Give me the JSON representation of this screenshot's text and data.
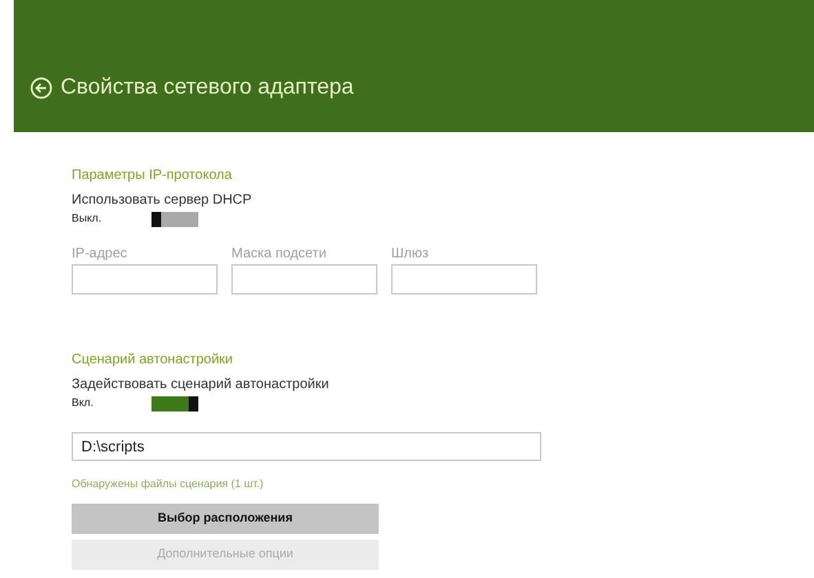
{
  "header": {
    "title": "Свойства сетевого адаптера"
  },
  "sections": [
    {
      "title": "Параметры IP-протокола",
      "toggle": {
        "label": "Использовать сервер DHCP",
        "state_text": "Выкл.",
        "on": false
      },
      "fields": [
        {
          "label": "IP-адрес"
        },
        {
          "label": "Маска подсети"
        },
        {
          "label": "Шлюз"
        }
      ]
    },
    {
      "title": "Сценарий автонастройки",
      "toggle": {
        "label": "Задействовать сценарий автонастройки",
        "state_text": "Вкл.",
        "on": true
      },
      "path": {
        "value": "D:\\scripts"
      },
      "note": "Обнаружены файлы сценария (1 шт.)",
      "buttons": [
        {
          "label": "Выбор расположения",
          "disabled": false
        },
        {
          "label": "Дополнительные опции",
          "disabled": true
        }
      ]
    }
  ]
}
